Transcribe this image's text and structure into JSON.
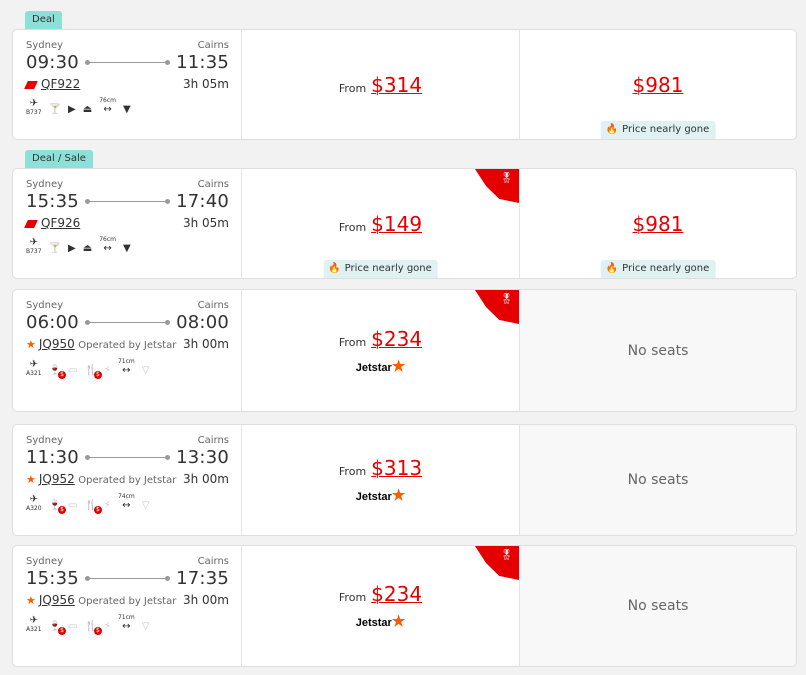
{
  "colors": {
    "accent_red": "#e40000",
    "tag_teal": "#8de0d8",
    "pill_bg": "#dff2f1",
    "jetstar_orange": "#ff5a00"
  },
  "flights": [
    {
      "tag": "Deal",
      "origin": "Sydney",
      "destination": "Cairns",
      "depart": "09:30",
      "arrive": "11:35",
      "airline_icon": "qantas-logo-icon",
      "flight_no": "QF922",
      "operated_by": "",
      "duration": "3h 05m",
      "amenities": [
        {
          "icon": "aircraft-icon",
          "label": "B737"
        },
        {
          "icon": "wine-glass-icon"
        },
        {
          "icon": "entertainment-icon"
        },
        {
          "icon": "meal-icon"
        },
        {
          "icon": "seat-pitch-icon",
          "label": "76cm"
        },
        {
          "icon": "wifi-icon"
        }
      ],
      "fare1": {
        "from": "From",
        "price": "$314",
        "ribbon": false,
        "pill": "",
        "carrier_logo": ""
      },
      "fare2": {
        "from": "",
        "price": "$981",
        "pill": "Price nearly gone",
        "no_seats": ""
      }
    },
    {
      "tag": "Deal / Sale",
      "origin": "Sydney",
      "destination": "Cairns",
      "depart": "15:35",
      "arrive": "17:40",
      "airline_icon": "qantas-logo-icon",
      "flight_no": "QF926",
      "operated_by": "",
      "duration": "3h 05m",
      "amenities": [
        {
          "icon": "aircraft-icon",
          "label": "B737"
        },
        {
          "icon": "wine-glass-icon"
        },
        {
          "icon": "entertainment-icon"
        },
        {
          "icon": "meal-icon"
        },
        {
          "icon": "seat-pitch-icon",
          "label": "76cm"
        },
        {
          "icon": "wifi-icon"
        }
      ],
      "fare1": {
        "from": "From",
        "price": "$149",
        "ribbon": true,
        "pill": "Price nearly gone",
        "carrier_logo": ""
      },
      "fare2": {
        "from": "",
        "price": "$981",
        "pill": "Price nearly gone",
        "no_seats": ""
      }
    },
    {
      "tag": "",
      "origin": "Sydney",
      "destination": "Cairns",
      "depart": "06:00",
      "arrive": "08:00",
      "airline_icon": "jetstar-star-icon",
      "flight_no": "JQ950",
      "operated_by": "Operated by Jetstar",
      "duration": "3h 00m",
      "amenities": [
        {
          "icon": "aircraft-icon",
          "label": "A321"
        },
        {
          "icon": "paid-drinks-icon"
        },
        {
          "icon": "no-entertainment-icon"
        },
        {
          "icon": "paid-meal-icon"
        },
        {
          "icon": "no-power-icon"
        },
        {
          "icon": "seat-pitch-icon",
          "label": "71cm"
        },
        {
          "icon": "no-wifi-icon"
        }
      ],
      "fare1": {
        "from": "From",
        "price": "$234",
        "ribbon": true,
        "pill": "",
        "carrier_logo": "Jetstar"
      },
      "fare2": {
        "from": "",
        "price": "",
        "pill": "",
        "no_seats": "No seats"
      }
    },
    {
      "tag": "",
      "origin": "Sydney",
      "destination": "Cairns",
      "depart": "11:30",
      "arrive": "13:30",
      "airline_icon": "jetstar-star-icon",
      "flight_no": "JQ952",
      "operated_by": "Operated by Jetstar",
      "duration": "3h 00m",
      "amenities": [
        {
          "icon": "aircraft-icon",
          "label": "A320"
        },
        {
          "icon": "paid-drinks-icon"
        },
        {
          "icon": "no-entertainment-icon"
        },
        {
          "icon": "paid-meal-icon"
        },
        {
          "icon": "no-power-icon"
        },
        {
          "icon": "seat-pitch-icon",
          "label": "74cm"
        },
        {
          "icon": "no-wifi-icon"
        }
      ],
      "fare1": {
        "from": "From",
        "price": "$313",
        "ribbon": false,
        "pill": "",
        "carrier_logo": "Jetstar"
      },
      "fare2": {
        "from": "",
        "price": "",
        "pill": "",
        "no_seats": "No seats"
      }
    },
    {
      "tag": "",
      "origin": "Sydney",
      "destination": "Cairns",
      "depart": "15:35",
      "arrive": "17:35",
      "airline_icon": "jetstar-star-icon",
      "flight_no": "JQ956",
      "operated_by": "Operated by Jetstar",
      "duration": "3h 00m",
      "amenities": [
        {
          "icon": "aircraft-icon",
          "label": "A321"
        },
        {
          "icon": "paid-drinks-icon"
        },
        {
          "icon": "no-entertainment-icon"
        },
        {
          "icon": "paid-meal-icon"
        },
        {
          "icon": "no-power-icon"
        },
        {
          "icon": "seat-pitch-icon",
          "label": "71cm"
        },
        {
          "icon": "no-wifi-icon"
        }
      ],
      "fare1": {
        "from": "From",
        "price": "$234",
        "ribbon": true,
        "pill": "",
        "carrier_logo": "Jetstar"
      },
      "fare2": {
        "from": "",
        "price": "",
        "pill": "",
        "no_seats": "No seats"
      }
    }
  ]
}
